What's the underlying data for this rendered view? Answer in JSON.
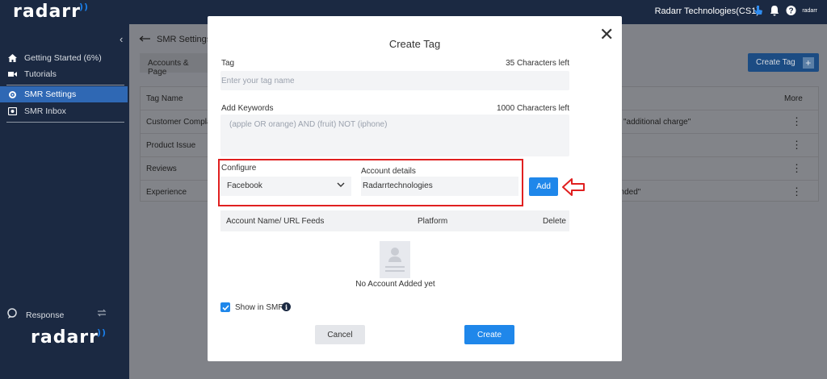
{
  "brand": {
    "name": "radarr",
    "mini": "radarr"
  },
  "topbar": {
    "org_name": "Radarr Technologies(CS1)",
    "icons": [
      "hand-pointer-icon",
      "bell-icon",
      "help-icon"
    ]
  },
  "sidebar": {
    "items": [
      {
        "label": "Getting Started (6%)",
        "icon": "home-icon"
      },
      {
        "label": "Tutorials",
        "icon": "video-icon"
      },
      {
        "label": "SMR Settings",
        "icon": "gear-icon",
        "active": true
      },
      {
        "label": "SMR Inbox",
        "icon": "inbox-icon"
      }
    ],
    "response_label": "Response"
  },
  "main": {
    "back_title": "SMR Settings",
    "tab_label": "Accounts & Page",
    "create_tag_label": "Create Tag",
    "table": {
      "headers": {
        "tag_name": "Tag Name",
        "more": "More"
      },
      "rows": [
        {
          "name": "Customer Compla",
          "extra": "R \"additional charge\""
        },
        {
          "name": "Product Issue",
          "extra": ""
        },
        {
          "name": "Reviews",
          "extra": ""
        },
        {
          "name": "Experience",
          "extra": "ended\""
        }
      ]
    }
  },
  "modal": {
    "title": "Create Tag",
    "tag_label": "Tag",
    "tag_count": "35 Characters left",
    "tag_placeholder": "Enter your tag name",
    "keywords_label": "Add Keywords",
    "keywords_count": "1000 Characters left",
    "keywords_placeholder": "(apple OR orange) AND (fruit) NOT (iphone)",
    "configure_label": "Configure",
    "configure_value": "Facebook",
    "account_details_label": "Account details",
    "account_details_value": "Radarrtechnologies",
    "add_label": "Add",
    "table_headers": {
      "account": "Account Name/ URL Feeds",
      "platform": "Platform",
      "delete": "Delete"
    },
    "empty_text": "No Account Added yet",
    "show_in_smr_label": "Show in SMR",
    "show_in_smr_checked": true,
    "cancel_label": "Cancel",
    "create_label": "Create"
  },
  "colors": {
    "navy": "#1b2942",
    "accent": "#1f87ea",
    "highlight_red": "#e02020",
    "active_nav": "#2f68b4"
  }
}
